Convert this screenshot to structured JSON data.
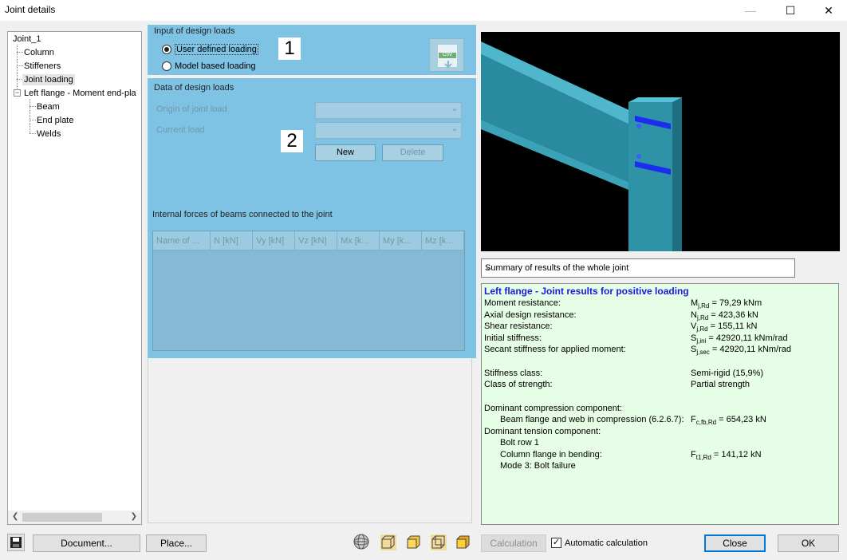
{
  "window": {
    "title": "Joint details"
  },
  "tree": {
    "root": "Joint_1",
    "items": [
      "Column",
      "Stiffeners",
      "Joint loading"
    ],
    "group": {
      "label": "Left flange - Moment end-pla",
      "expander": "−",
      "children": [
        "Beam",
        "End plate",
        "Welds"
      ]
    }
  },
  "input_group": {
    "title": "Input of design loads",
    "option_user": "User defined loading",
    "option_model": "Model based loading",
    "badge": "1",
    "csv_label": "CSV"
  },
  "data_group": {
    "title": "Data of design loads",
    "origin_label": "Origin of joint load",
    "current_label": "Current load",
    "badge": "2",
    "new_button": "New",
    "delete_button": "Delete",
    "forces_title": "Internal forces of beams connected to the joint",
    "columns": [
      "Name of ...",
      "N [kN]",
      "Vy [kN]",
      "Vz [kN]",
      "Mx [k...",
      "My [k...",
      "Mz [k..."
    ]
  },
  "summary_select": {
    "value": "Summary of results of the whole joint"
  },
  "results": {
    "title": "Left flange - Joint results for positive loading",
    "rows": [
      {
        "label": "Moment resistance:",
        "sym": "M",
        "sub": "j,Rd",
        "value": " = 79,29 kNm"
      },
      {
        "label": "Axial design resistance:",
        "sym": "N",
        "sub": "j,Rd",
        "value": " = 423,36 kN"
      },
      {
        "label": "Shear resistance:",
        "sym": "V",
        "sub": "j,Rd",
        "value": " = 155,11 kN"
      },
      {
        "label": "Initial stiffness:",
        "sym": "S",
        "sub": "j,ini",
        "value": " = 42920,11 kNm/rad"
      },
      {
        "label": "Secant stiffness for applied moment:",
        "sym": "S",
        "sub": "j,sec",
        "value": " = 42920,11 kNm/rad"
      }
    ],
    "stiffness_class_label": "Stiffness class:",
    "stiffness_class_value": "Semi-rigid (15,9%)",
    "strength_class_label": "Class of strength:",
    "strength_class_value": "Partial strength",
    "dominant_compression": "Dominant compression component:",
    "compression_item": "Beam flange and web in compression (6.2.6.7):",
    "compression_sym": "F",
    "compression_sub": "c,fb,Rd",
    "compression_value": " = 654,23 kN",
    "dominant_tension": "Dominant tension component:",
    "bolt_row": "Bolt row 1",
    "tension_item": "Column flange in bending:",
    "tension_sym": "F",
    "tension_sub": "t1,Rd",
    "tension_value": " = 141,12 kN",
    "mode": "Mode 3: Bolt failure"
  },
  "toolbar": {
    "document_button": "Document...",
    "place_button": "Place...",
    "calculation_button": "Calculation",
    "auto_calc_label": "Automatic calculation",
    "auto_calc_checked": true,
    "close_button": "Close",
    "ok_button": "OK"
  },
  "colors": {
    "panel_blue": "#7ec3e4",
    "results_bg": "#e6fde6",
    "results_title": "#1a1adc",
    "steel": "#2d8ea3",
    "stiffener": "#1c2df0"
  }
}
